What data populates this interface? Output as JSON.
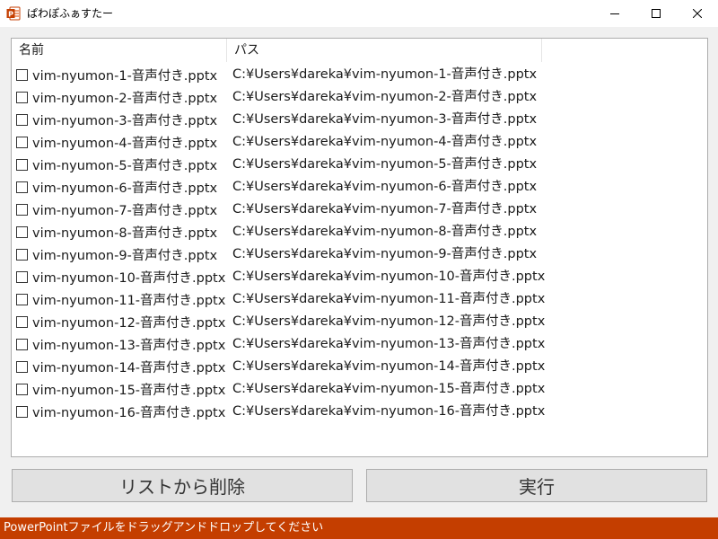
{
  "window": {
    "title": "ぱわぽふぁすたー",
    "icon": "powerpoint-icon",
    "controls": [
      "minimize-icon",
      "maximize-icon",
      "close-icon"
    ]
  },
  "list": {
    "columns": {
      "name": "名前",
      "path": "パス"
    },
    "rows": [
      {
        "name": "vim-nyumon-1-音声付き.pptx",
        "path": "C:¥Users¥dareka¥vim-nyumon-1-音声付き.pptx"
      },
      {
        "name": "vim-nyumon-2-音声付き.pptx",
        "path": "C:¥Users¥dareka¥vim-nyumon-2-音声付き.pptx"
      },
      {
        "name": "vim-nyumon-3-音声付き.pptx",
        "path": "C:¥Users¥dareka¥vim-nyumon-3-音声付き.pptx"
      },
      {
        "name": "vim-nyumon-4-音声付き.pptx",
        "path": "C:¥Users¥dareka¥vim-nyumon-4-音声付き.pptx"
      },
      {
        "name": "vim-nyumon-5-音声付き.pptx",
        "path": "C:¥Users¥dareka¥vim-nyumon-5-音声付き.pptx"
      },
      {
        "name": "vim-nyumon-6-音声付き.pptx",
        "path": "C:¥Users¥dareka¥vim-nyumon-6-音声付き.pptx"
      },
      {
        "name": "vim-nyumon-7-音声付き.pptx",
        "path": "C:¥Users¥dareka¥vim-nyumon-7-音声付き.pptx"
      },
      {
        "name": "vim-nyumon-8-音声付き.pptx",
        "path": "C:¥Users¥dareka¥vim-nyumon-8-音声付き.pptx"
      },
      {
        "name": "vim-nyumon-9-音声付き.pptx",
        "path": "C:¥Users¥dareka¥vim-nyumon-9-音声付き.pptx"
      },
      {
        "name": "vim-nyumon-10-音声付き.pptx",
        "path": "C:¥Users¥dareka¥vim-nyumon-10-音声付き.pptx"
      },
      {
        "name": "vim-nyumon-11-音声付き.pptx",
        "path": "C:¥Users¥dareka¥vim-nyumon-11-音声付き.pptx"
      },
      {
        "name": "vim-nyumon-12-音声付き.pptx",
        "path": "C:¥Users¥dareka¥vim-nyumon-12-音声付き.pptx"
      },
      {
        "name": "vim-nyumon-13-音声付き.pptx",
        "path": "C:¥Users¥dareka¥vim-nyumon-13-音声付き.pptx"
      },
      {
        "name": "vim-nyumon-14-音声付き.pptx",
        "path": "C:¥Users¥dareka¥vim-nyumon-14-音声付き.pptx"
      },
      {
        "name": "vim-nyumon-15-音声付き.pptx",
        "path": "C:¥Users¥dareka¥vim-nyumon-15-音声付き.pptx"
      },
      {
        "name": "vim-nyumon-16-音声付き.pptx",
        "path": "C:¥Users¥dareka¥vim-nyumon-16-音声付き.pptx"
      }
    ]
  },
  "buttons": {
    "remove": "リストから削除",
    "run": "実行"
  },
  "status": {
    "text": "PowerPointファイルをドラッグアンドドロップしてください",
    "color": "#c43e00"
  }
}
